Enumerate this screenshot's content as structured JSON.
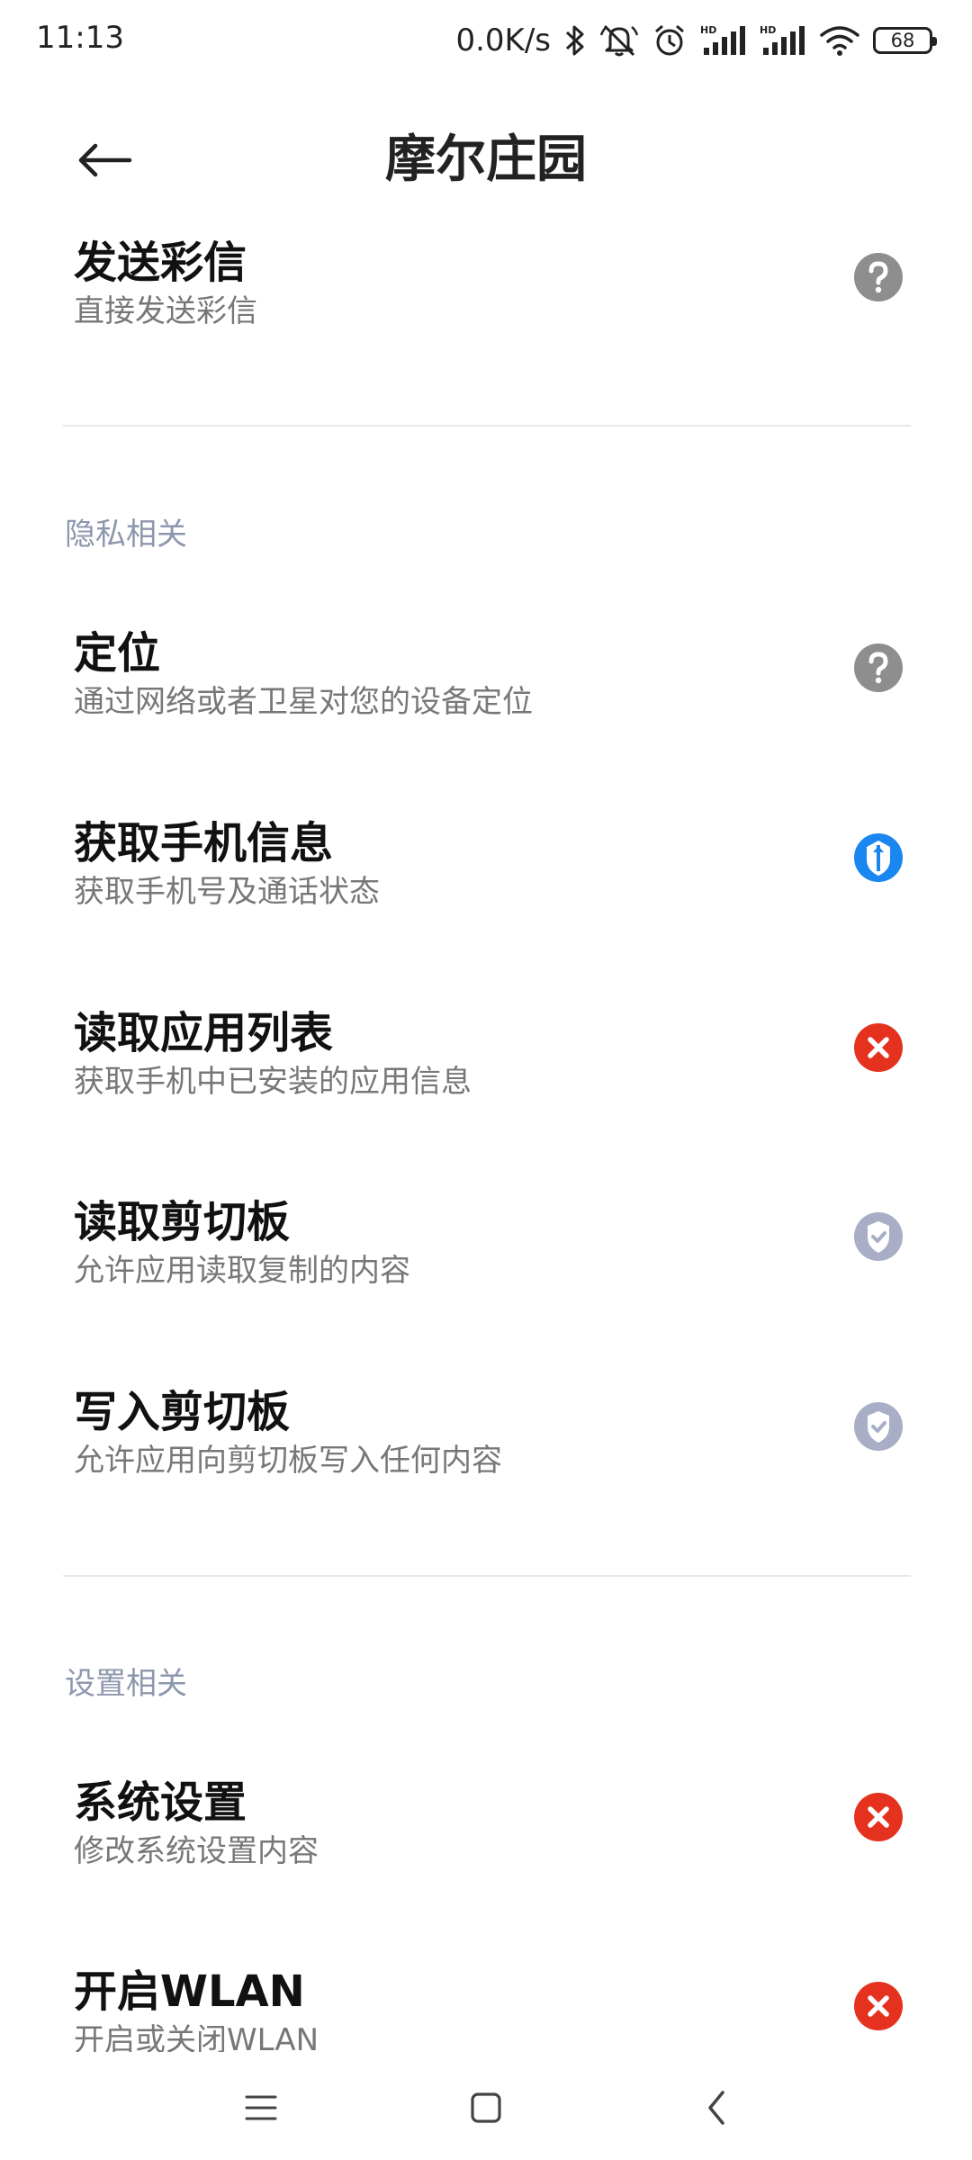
{
  "status_bar": {
    "time": "11:13",
    "net_speed": "0.0K/s",
    "battery": "68",
    "icons": [
      "bluetooth-icon",
      "mute-icon",
      "alarm-icon",
      "signal-hd-icon",
      "signal-hd-icon",
      "wifi-icon",
      "battery-icon"
    ]
  },
  "header": {
    "title": "摩尔庄园",
    "back_icon": "arrow-left-icon"
  },
  "items_top": [
    {
      "title": "发送彩信",
      "desc": "直接发送彩信",
      "status": "unknown"
    }
  ],
  "sections": [
    {
      "header": "隐私相关",
      "items": [
        {
          "title": "定位",
          "desc": "通过网络或者卫星对您的设备定位",
          "status": "unknown"
        },
        {
          "title": "获取手机信息",
          "desc": "获取手机号及通话状态",
          "status": "ask"
        },
        {
          "title": "读取应用列表",
          "desc": "获取手机中已安装的应用信息",
          "status": "denied"
        },
        {
          "title": "读取剪切板",
          "desc": "允许应用读取复制的内容",
          "status": "allowed"
        },
        {
          "title": "写入剪切板",
          "desc": "允许应用向剪切板写入任何内容",
          "status": "allowed"
        }
      ]
    },
    {
      "header": "设置相关",
      "items": [
        {
          "title": "系统设置",
          "desc": "修改系统设置内容",
          "status": "denied"
        },
        {
          "title": "开启WLAN",
          "desc": "开启或关闭WLAN",
          "status": "denied"
        }
      ]
    }
  ],
  "colors": {
    "unknown": "#8e8e8e",
    "ask": "#1a86f0",
    "denied": "#e5321f",
    "allowed": "#a7aec6",
    "section_header": "#8d97ad"
  },
  "nav": {
    "icons": [
      "menu-icon",
      "home-square-icon",
      "back-chevron-icon"
    ]
  }
}
